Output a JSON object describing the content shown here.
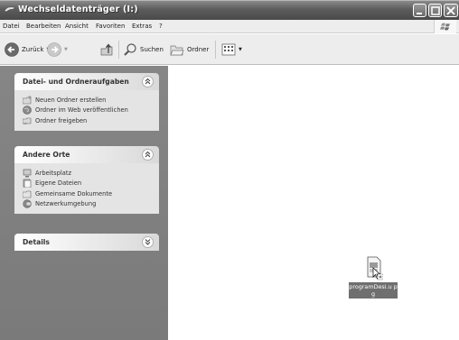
{
  "window": {
    "title": "Wechseldatenträger (I:)"
  },
  "menubar": {
    "items": [
      {
        "label": "Datei"
      },
      {
        "label": "Bearbeiten"
      },
      {
        "label": "Ansicht"
      },
      {
        "label": "Favoriten"
      },
      {
        "label": "Extras"
      },
      {
        "label": "?"
      }
    ]
  },
  "toolbar": {
    "back_label": "Zurück",
    "search_label": "Suchen",
    "folders_label": "Ordner"
  },
  "tasks_panel": {
    "title": "Datei- und Ordneraufgaben",
    "items": [
      {
        "label": "Neuen Ordner erstellen",
        "icon": "new-folder-icon"
      },
      {
        "label": "Ordner im Web veröffentlichen",
        "icon": "globe-icon"
      },
      {
        "label": "Ordner freigeben",
        "icon": "share-folder-icon"
      }
    ]
  },
  "places_panel": {
    "title": "Andere Orte",
    "items": [
      {
        "label": "Arbeitsplatz",
        "icon": "computer-icon"
      },
      {
        "label": "Eigene Dateien",
        "icon": "documents-icon"
      },
      {
        "label": "Gemeinsame Dokumente",
        "icon": "folder-icon"
      },
      {
        "label": "Netzwerkumgebung",
        "icon": "network-icon"
      }
    ]
  },
  "details_panel": {
    "title": "Details"
  },
  "files": [
    {
      "name": "programDesi.upg",
      "display_name": "programDesi.u pg",
      "selected": true,
      "icon": "file-icon"
    }
  ]
}
